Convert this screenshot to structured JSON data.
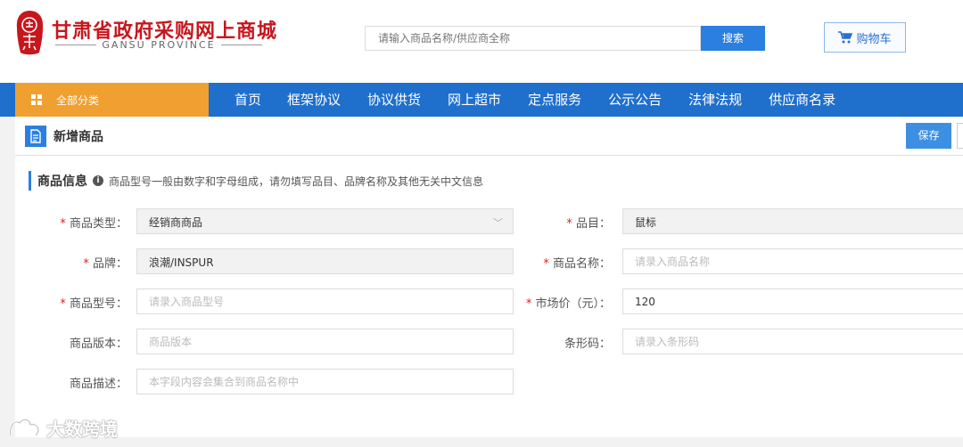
{
  "header": {
    "logo_seal_text": "甘肃",
    "logo_title": "甘肃省政府采购网上商城",
    "logo_subtitle": "GANSU PROVINCE",
    "search_placeholder": "请输入商品名称/供应商全称",
    "search_button": "搜索",
    "cart_label": "购物车"
  },
  "nav": {
    "all_categories": "全部分类",
    "items": [
      "首页",
      "框架协议",
      "协议供货",
      "网上超市",
      "定点服务",
      "公示公告",
      "法律法规",
      "供应商名录"
    ]
  },
  "page": {
    "title": "新增商品",
    "save_button": "保存"
  },
  "section": {
    "title": "商品信息",
    "note": "商品型号一般由数字和字母组成，请勿填写品目、品牌名称及其他无关中文信息"
  },
  "form": {
    "product_type": {
      "label": "商品类型：",
      "value": "经销商商品"
    },
    "category": {
      "label": "品目：",
      "value": "鼠标"
    },
    "brand": {
      "label": "品牌：",
      "value": "浪潮/INSPUR"
    },
    "product_name": {
      "label": "商品名称：",
      "placeholder": "请录入商品名称"
    },
    "model": {
      "label": "商品型号：",
      "placeholder": "请录入商品型号"
    },
    "market_price": {
      "label": "市场价（元）：",
      "value": "120"
    },
    "version": {
      "label": "商品版本：",
      "placeholder": "商品版本"
    },
    "barcode": {
      "label": "条形码：",
      "placeholder": "请录入条形码"
    },
    "description": {
      "label": "商品描述：",
      "placeholder": "本字段内容会集合到商品名称中"
    },
    "required_mark": "*"
  },
  "watermark": "大数跨境",
  "colors": {
    "brand_red": "#c8161d",
    "nav_blue": "#1f6fcd",
    "accent_orange": "#f0a030",
    "button_blue": "#2a7fe0"
  }
}
